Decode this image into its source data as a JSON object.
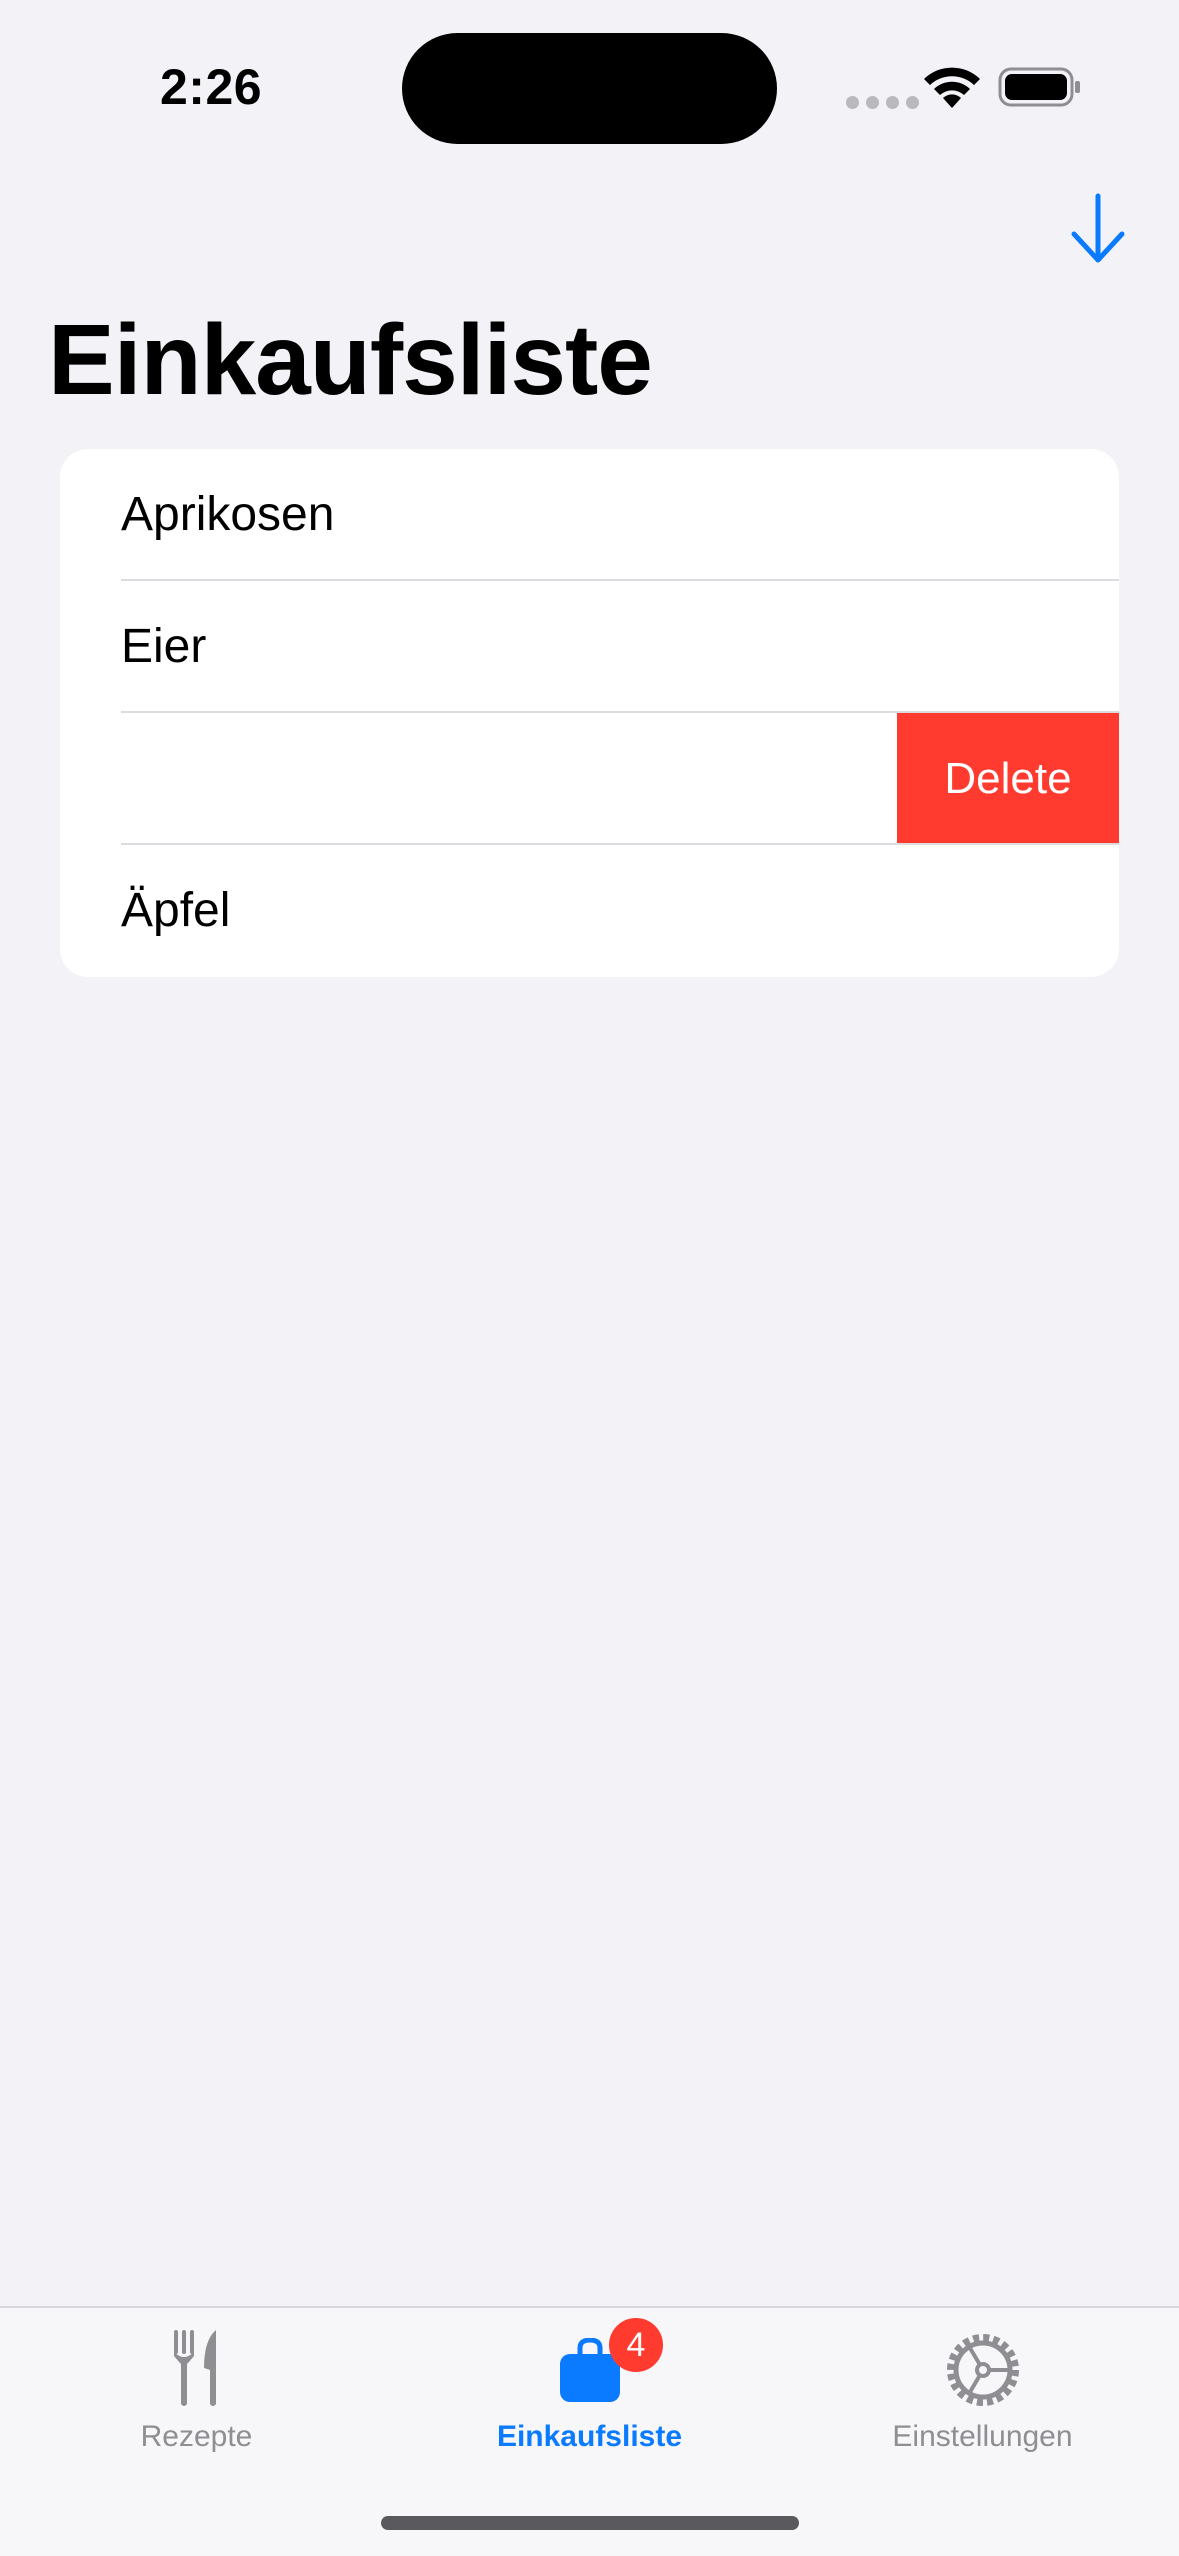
{
  "status_bar": {
    "time": "2:26"
  },
  "nav": {
    "title": "Einkaufsliste",
    "download_icon": "arrow-down-icon"
  },
  "list": {
    "items": [
      {
        "label": "Aprikosen"
      },
      {
        "label": "Eier"
      },
      {
        "label": ""
      },
      {
        "label": "Äpfel"
      }
    ],
    "swiped_row_index": 2,
    "delete_label": "Delete"
  },
  "tabbar": {
    "tabs": [
      {
        "label": "Rezepte",
        "icon": "fork-knife-icon",
        "active": false
      },
      {
        "label": "Einkaufsliste",
        "icon": "shopping-bag-icon",
        "active": true,
        "badge": "4"
      },
      {
        "label": "Einstellungen",
        "icon": "gear-icon",
        "active": false
      }
    ]
  },
  "colors": {
    "accent": "#0a7aff",
    "destructive": "#ff3b30",
    "background": "#f2f2f7",
    "inactive_tab": "#8e8e93"
  }
}
